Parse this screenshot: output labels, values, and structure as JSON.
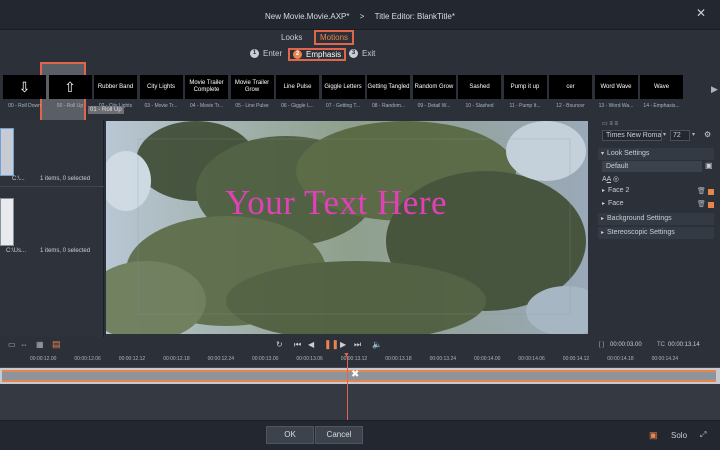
{
  "titlebar": {
    "movie": "New Movie.Movie.AXP*",
    "separator": ">",
    "editor": "Title Editor: BlankTitle*"
  },
  "tabs": {
    "looks": "Looks",
    "motions": "Motions"
  },
  "subtabs": {
    "enter": {
      "num": "1",
      "label": "Enter"
    },
    "emphasis": {
      "num": "2",
      "label": "Emphasis"
    },
    "exit": {
      "num": "3",
      "label": "Exit"
    }
  },
  "thumbnails": [
    {
      "art": "⇩",
      "caption": "00 - Roll Down"
    },
    {
      "art": "⇧",
      "caption": "00 - Roll Up"
    },
    {
      "art": "Rubber Band",
      "caption": "02 - City Lights"
    },
    {
      "art": "City Lights",
      "caption": "03 - Movie Tr..."
    },
    {
      "art": "Movie Trailer Complete",
      "caption": "04 - Movie Tr..."
    },
    {
      "art": "Movie Trailer Grow",
      "caption": "05 - Line Pulse"
    },
    {
      "art": "Line Pulse",
      "caption": "06 - Giggle L..."
    },
    {
      "art": "Giggle Letters",
      "caption": "07 - Getting T..."
    },
    {
      "art": "Getting Tangled",
      "caption": "08 - Random..."
    },
    {
      "art": "Random Grow",
      "caption": "09 - Detail W..."
    },
    {
      "art": "Sashed",
      "caption": "10 - Slashed"
    },
    {
      "art": "Pump it up",
      "caption": "11 - Pump It..."
    },
    {
      "art": "cer",
      "caption": "12 - Bouncer"
    },
    {
      "art": "Word Wave",
      "caption": "13 - Word Wa..."
    },
    {
      "art": "Wave",
      "caption": "14 - Emphasis..."
    }
  ],
  "hover_tip": "01 - Roll Up",
  "left_panel": {
    "item1_name": "C:\\...",
    "item1_info": "1 items, 0 selected",
    "item2_name": "C:\\Us...",
    "item2_info": "1 items, 0 selected"
  },
  "preview": {
    "text": "Your Text Here",
    "text_color": "#e040b8"
  },
  "right_panel": {
    "font": "Times New Roman",
    "size": "72",
    "look_settings": "Look Settings",
    "default": "Default",
    "face2": "Face 2",
    "face": "Face",
    "background_settings": "Background Settings",
    "stereoscopic_settings": "Stereoscopic Settings"
  },
  "transport": {
    "timecode_in": "00:00:03.00",
    "timecode_tc": "00:00:13.14",
    "tc_label": "TC"
  },
  "ruler_ticks": [
    "00:00:12.00",
    "00:00:12.06",
    "00:00:12.12",
    "00:00:12.18",
    "00:00:12.24",
    "00:00:13.00",
    "00:00:13.06",
    "00:00:13.12",
    "00:00:13.18",
    "00:00:13.24",
    "00:00:14.00",
    "00:00:14.06",
    "00:00:14.12",
    "00:00:14.18",
    "00:00:14.24"
  ],
  "buttons": {
    "ok": "OK",
    "cancel": "Cancel",
    "solo": "Solo"
  },
  "colors": {
    "accent": "#e0654a",
    "orange": "#e8854c",
    "background": "#2b3039"
  }
}
